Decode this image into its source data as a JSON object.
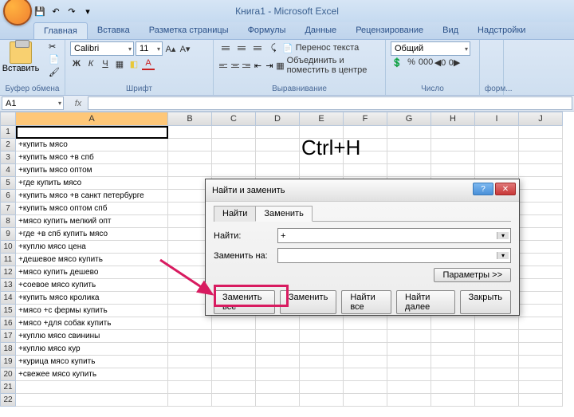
{
  "app": {
    "title": "Книга1 - Microsoft Excel"
  },
  "ribbon": {
    "tabs": [
      "Главная",
      "Вставка",
      "Разметка страницы",
      "Формулы",
      "Данные",
      "Рецензирование",
      "Вид",
      "Надстройки"
    ],
    "paste": "Вставить",
    "font_name": "Calibri",
    "font_size": "11",
    "wrap_text": "Перенос текста",
    "merge_center": "Объединить и поместить в центре",
    "number_format": "Общий",
    "group_clipboard": "Буфер обмена",
    "group_font": "Шрифт",
    "group_align": "Выравнивание",
    "group_number": "Число",
    "group_format": "форм..."
  },
  "namebox": "A1",
  "columns": [
    "A",
    "B",
    "C",
    "D",
    "E",
    "F",
    "G",
    "H",
    "I",
    "J"
  ],
  "col_widths": {
    "A": 191,
    "others": 55
  },
  "rows": [
    "",
    "+купить мясо",
    "+купить мясо +в спб",
    "+купить мясо оптом",
    "+где купить мясо",
    "+купить мясо +в санкт петербурге",
    "+купить мясо оптом спб",
    "+мясо купить мелкий опт",
    "+где +в спб купить мясо",
    "+куплю мясо цена",
    "+дешевое мясо купить",
    "+мясо купить дешево",
    "+соевое мясо купить",
    "+купить мясо кролика",
    "+мясо +с фермы купить",
    "+мясо +для собак купить",
    "+куплю мясо свинины",
    "+куплю мясо кур",
    "+курица мясо купить",
    "+свежее мясо купить"
  ],
  "overlay_hint": "Ctrl+H",
  "dialog": {
    "title": "Найти и заменить",
    "tab_find": "Найти",
    "tab_replace": "Заменить",
    "label_find": "Найти:",
    "label_replace": "Заменить на:",
    "find_value": "+",
    "replace_value": "",
    "btn_params": "Параметры >>",
    "btn_replace_all": "Заменить все",
    "btn_replace": "Заменить",
    "btn_find_all": "Найти все",
    "btn_find_next": "Найти далее",
    "btn_close": "Закрыть"
  },
  "icons": {
    "save": "💾",
    "undo": "↶",
    "redo": "↷",
    "qat_more": "▾",
    "cut": "✂",
    "copy": "📄",
    "brush": "🖌",
    "grow_font": "A▴",
    "shrink_font": "A▾",
    "bold": "Ж",
    "italic": "К",
    "underline": "Ч",
    "border": "▦",
    "fill": "◧",
    "font_color": "A",
    "decimal_inc": "◀0",
    "decimal_dec": "0▶",
    "help": "?",
    "close": "✕",
    "fx": "fx"
  }
}
